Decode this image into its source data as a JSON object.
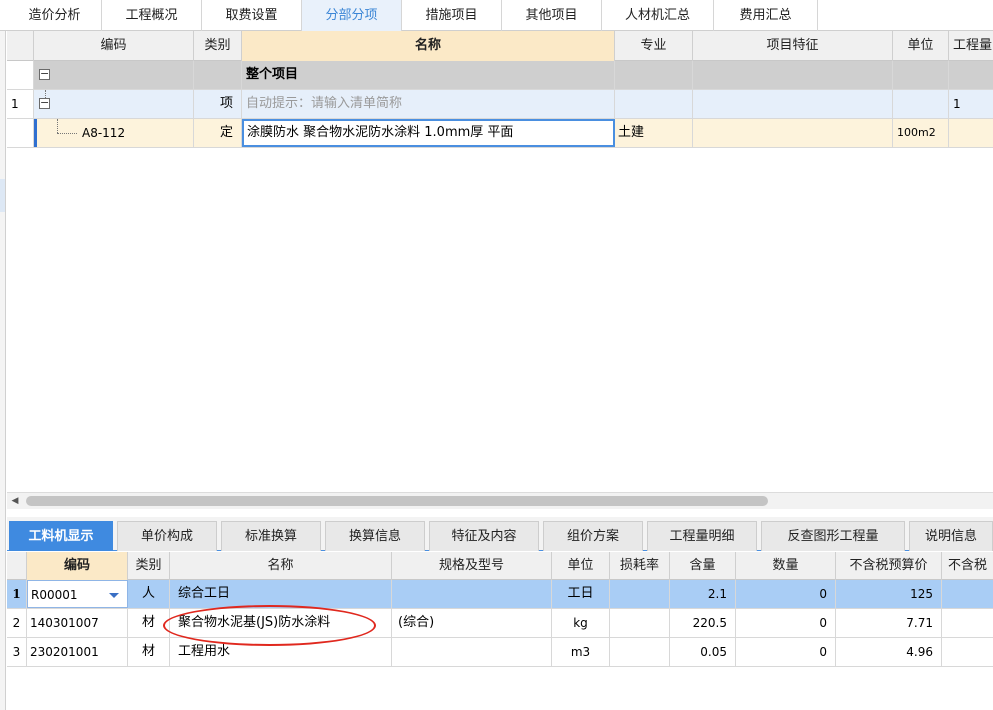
{
  "top_tabs": [
    "造价分析",
    "工程概况",
    "取费设置",
    "分部分项",
    "措施项目",
    "其他项目",
    "人材机汇总",
    "费用汇总"
  ],
  "top_tabs_active": "分部分项",
  "upper_grid": {
    "headers": [
      "编码",
      "类别",
      "名称",
      "专业",
      "项目特征",
      "单位",
      "工程量"
    ],
    "rows": [
      {
        "num": "",
        "code": "",
        "type": "",
        "name": "整个项目",
        "spec": "",
        "feature": "",
        "unit": "",
        "qty": ""
      },
      {
        "num": "1",
        "code": "",
        "type": "项",
        "name": "自动提示：请输入清单简称",
        "spec": "",
        "feature": "",
        "unit": "",
        "qty": "1"
      },
      {
        "num": "",
        "code": "A8-112",
        "type": "定",
        "name": "涂膜防水 聚合物水泥防水涂料 1.0mm厚 平面",
        "spec": "土建",
        "feature": "",
        "unit": "100m2",
        "qty": ""
      }
    ]
  },
  "bottom_tabs": [
    "工料机显示",
    "单价构成",
    "标准换算",
    "换算信息",
    "特征及内容",
    "组价方案",
    "工程量明细",
    "反查图形工程量",
    "说明信息"
  ],
  "bottom_tabs_active": "工料机显示",
  "lower_grid": {
    "headers": [
      "编码",
      "类别",
      "名称",
      "规格及型号",
      "单位",
      "损耗率",
      "含量",
      "数量",
      "不含税预算价",
      "不含税"
    ],
    "rows": [
      {
        "num": "1",
        "code": "R00001",
        "type": "人",
        "name": "综合工日",
        "model": "",
        "unit": "工日",
        "loss": "",
        "content": "2.1",
        "qty": "0",
        "price": "125"
      },
      {
        "num": "2",
        "code": "140301007",
        "type": "材",
        "name": "聚合物水泥基(JS)防水涂料",
        "model": "(综合)",
        "unit": "kg",
        "loss": "",
        "content": "220.5",
        "qty": "0",
        "price": "7.71"
      },
      {
        "num": "3",
        "code": "230201001",
        "type": "材",
        "name": "工程用水",
        "model": "",
        "unit": "m3",
        "loss": "",
        "content": "0.05",
        "qty": "0",
        "price": "4.96"
      }
    ]
  },
  "colors": {
    "accent": "#3f8ae0",
    "selected_row": "#a9cdf5",
    "header_highlight": "#fbe9c7",
    "annotation": "#e0281e"
  }
}
